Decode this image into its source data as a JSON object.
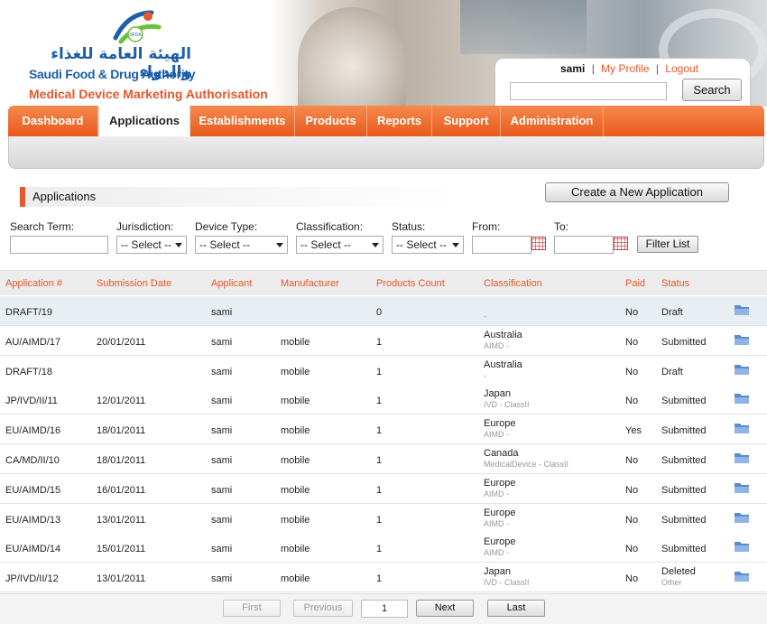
{
  "brand": {
    "arabic_name": "الهيئة العامة للغذاء والدواء",
    "english_name": "Saudi Food & Drug Authority",
    "app_title": "Medical Device Marketing Authorisation",
    "logo_badge": "SFDA"
  },
  "user": {
    "name": "sami",
    "separator": "|",
    "profile_link": "My Profile",
    "logout_link": "Logout"
  },
  "search": {
    "value": "",
    "button_label": "Search"
  },
  "nav": {
    "items": [
      {
        "label": "Dashboard",
        "active": false
      },
      {
        "label": "Applications",
        "active": true
      },
      {
        "label": "Establishments",
        "active": false
      },
      {
        "label": "Products",
        "active": false
      },
      {
        "label": "Reports",
        "active": false
      },
      {
        "label": "Support",
        "active": false
      },
      {
        "label": "Administration",
        "active": false
      }
    ]
  },
  "page": {
    "title": "Applications",
    "create_button": "Create a New Application"
  },
  "filters": {
    "search_term_label": "Search Term:",
    "jurisdiction_label": "Jurisdiction:",
    "device_type_label": "Device Type:",
    "classification_label": "Classification:",
    "status_label": "Status:",
    "from_label": "From:",
    "to_label": "To:",
    "select_placeholder": "-- Select --",
    "filter_button": "Filter List"
  },
  "table": {
    "headers": {
      "application": "Application #",
      "submission": "Submission Date",
      "applicant": "Applicant",
      "manufacturer": "Manufacturer",
      "products_count": "Products Count",
      "classification": "Classification",
      "paid": "Paid",
      "status": "Status"
    },
    "rows": [
      {
        "app": "DRAFT/19",
        "date": "",
        "applicant": "sami",
        "manufacturer": "",
        "count": "0",
        "cls_main": "",
        "cls_sub": "-",
        "paid": "No",
        "status": "Draft",
        "status_sub": ""
      },
      {
        "app": "AU/AIMD/17",
        "date": "20/01/2011",
        "applicant": "sami",
        "manufacturer": "mobile",
        "count": "1",
        "cls_main": "Australia",
        "cls_sub": "AIMD -",
        "paid": "No",
        "status": "Submitted",
        "status_sub": ""
      },
      {
        "app": "DRAFT/18",
        "date": "",
        "applicant": "sami",
        "manufacturer": "mobile",
        "count": "1",
        "cls_main": "Australia",
        "cls_sub": "-",
        "paid": "No",
        "status": "Draft",
        "status_sub": ""
      },
      {
        "app": "JP/IVD/II/11",
        "date": "12/01/2011",
        "applicant": "sami",
        "manufacturer": "mobile",
        "count": "1",
        "cls_main": "Japan",
        "cls_sub": "IVD - ClassII",
        "paid": "No",
        "status": "Submitted",
        "status_sub": ""
      },
      {
        "app": "EU/AIMD/16",
        "date": "18/01/2011",
        "applicant": "sami",
        "manufacturer": "mobile",
        "count": "1",
        "cls_main": "Europe",
        "cls_sub": "AIMD -",
        "paid": "Yes",
        "status": "Submitted",
        "status_sub": ""
      },
      {
        "app": "CA/MD/II/10",
        "date": "18/01/2011",
        "applicant": "sami",
        "manufacturer": "mobile",
        "count": "1",
        "cls_main": "Canada",
        "cls_sub": "MedicalDevice - ClassII",
        "paid": "No",
        "status": "Submitted",
        "status_sub": ""
      },
      {
        "app": "EU/AIMD/15",
        "date": "16/01/2011",
        "applicant": "sami",
        "manufacturer": "mobile",
        "count": "1",
        "cls_main": "Europe",
        "cls_sub": "AIMD -",
        "paid": "No",
        "status": "Submitted",
        "status_sub": ""
      },
      {
        "app": "EU/AIMD/13",
        "date": "13/01/2011",
        "applicant": "sami",
        "manufacturer": "mobile",
        "count": "1",
        "cls_main": "Europe",
        "cls_sub": "AIMD -",
        "paid": "No",
        "status": "Submitted",
        "status_sub": ""
      },
      {
        "app": "EU/AIMD/14",
        "date": "15/01/2011",
        "applicant": "sami",
        "manufacturer": "mobile",
        "count": "1",
        "cls_main": "Europe",
        "cls_sub": "AIMD -",
        "paid": "No",
        "status": "Submitted",
        "status_sub": ""
      },
      {
        "app": "JP/IVD/II/12",
        "date": "13/01/2011",
        "applicant": "sami",
        "manufacturer": "mobile",
        "count": "1",
        "cls_main": "Japan",
        "cls_sub": "IVD - ClassII",
        "paid": "No",
        "status": "Deleted",
        "status_sub": "Other"
      }
    ]
  },
  "pager": {
    "first": "First",
    "previous": "Previous",
    "page_value": "1",
    "next": "Next",
    "last": "Last"
  },
  "colors": {
    "accent": "#e8562a",
    "brand_blue": "#1c5ea8",
    "folder": "#5b8ccf"
  }
}
